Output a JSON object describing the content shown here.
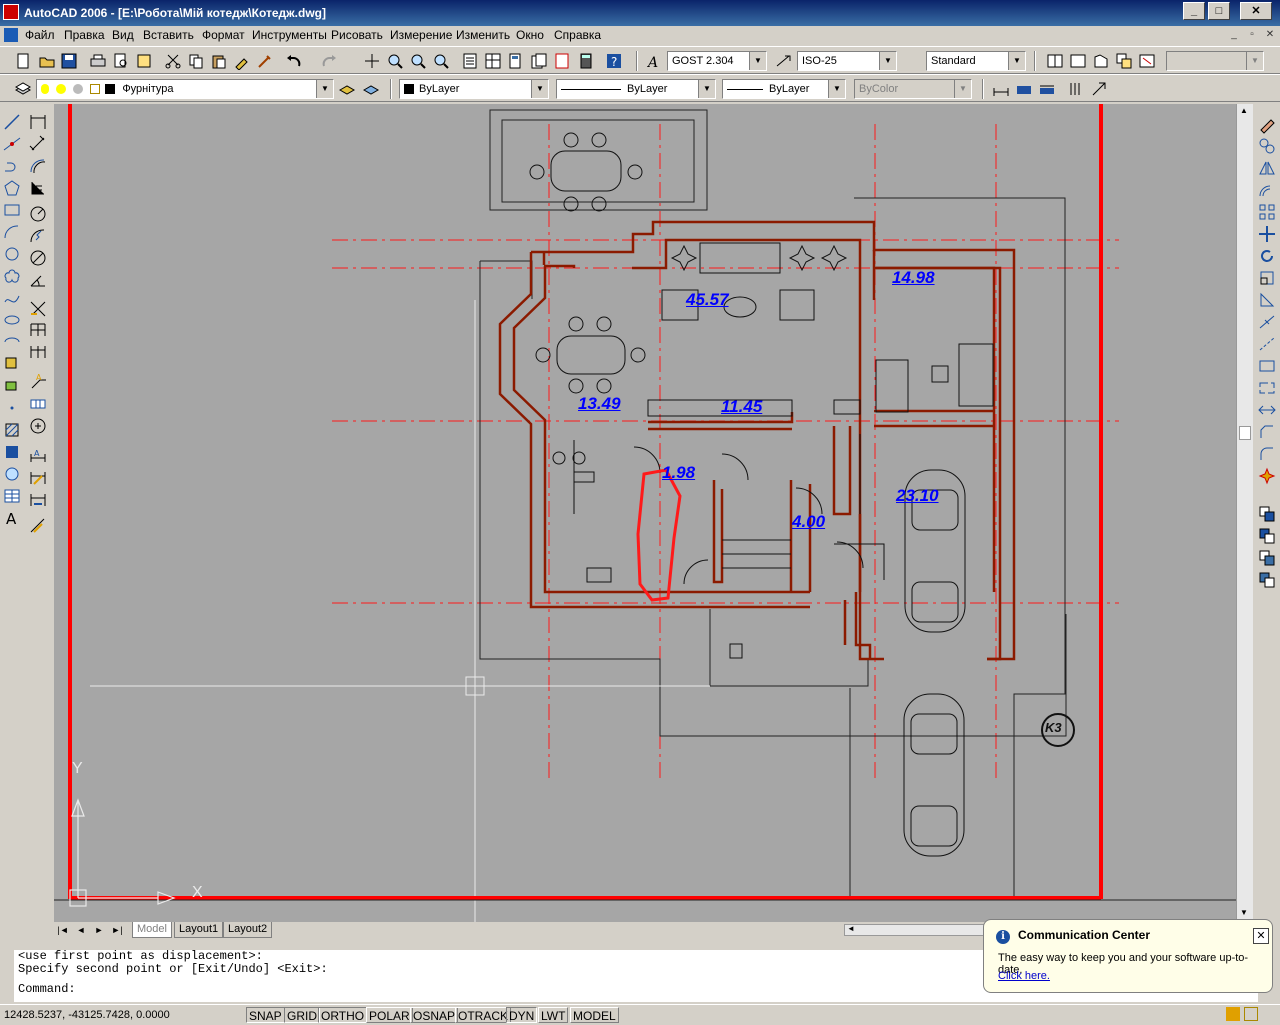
{
  "window": {
    "title": "AutoCAD 2006 - [E:\\Робота\\Мій котедж\\Котедж.dwg]",
    "min": "_",
    "max": "□",
    "close": "✕"
  },
  "menu": {
    "items": [
      "Файл",
      "Правка",
      "Вид",
      "Вставить",
      "Формат",
      "Инструменты",
      "Рисовать",
      "Измерение",
      "Изменить",
      "Окно",
      "Справка"
    ]
  },
  "toolbar": {
    "text_style": "GOST 2.304",
    "dim_style": "ISO-25",
    "table_style": "Standard",
    "layer": "Фурнітура",
    "color": "ByLayer",
    "linetype": "ByLayer",
    "lineweight": "ByLayer",
    "plotstyle": "ByColor",
    "combo_arrow": "▼"
  },
  "drawing": {
    "areas": [
      "45.57",
      "14.98",
      "13.49",
      "11.45",
      "23.10",
      "4.00",
      "1.98"
    ],
    "marker": "K3",
    "ucs_y": "Y",
    "ucs_x": "X"
  },
  "tabs": {
    "nav": [
      "|◄",
      "◄",
      "►",
      "►|"
    ],
    "items": [
      "Model",
      "Layout1",
      "Layout2"
    ]
  },
  "command": {
    "lines": [
      "<use first point as displacement>:",
      "Specify second point or [Exit/Undo] <Exit>:",
      "Command:"
    ]
  },
  "status": {
    "coords": "12428.5237, -43125.7428, 0.0000",
    "buttons": [
      "SNAP",
      "GRID",
      "ORTHO",
      "POLAR",
      "OSNAP",
      "OTRACK",
      "DYN",
      "LWT",
      "MODEL"
    ]
  },
  "comm_center": {
    "title": "Communication Center",
    "message": "The easy way to keep you and your software up-to-date.",
    "link": "Click here.",
    "info_glyph": "i",
    "close_glyph": "✕"
  },
  "colors": {
    "wall": "#8b1a00",
    "frame": "#ff0000",
    "area_text": "#0000ff",
    "canvas": "#a6a6a6",
    "axis": "#ff1a1a"
  }
}
